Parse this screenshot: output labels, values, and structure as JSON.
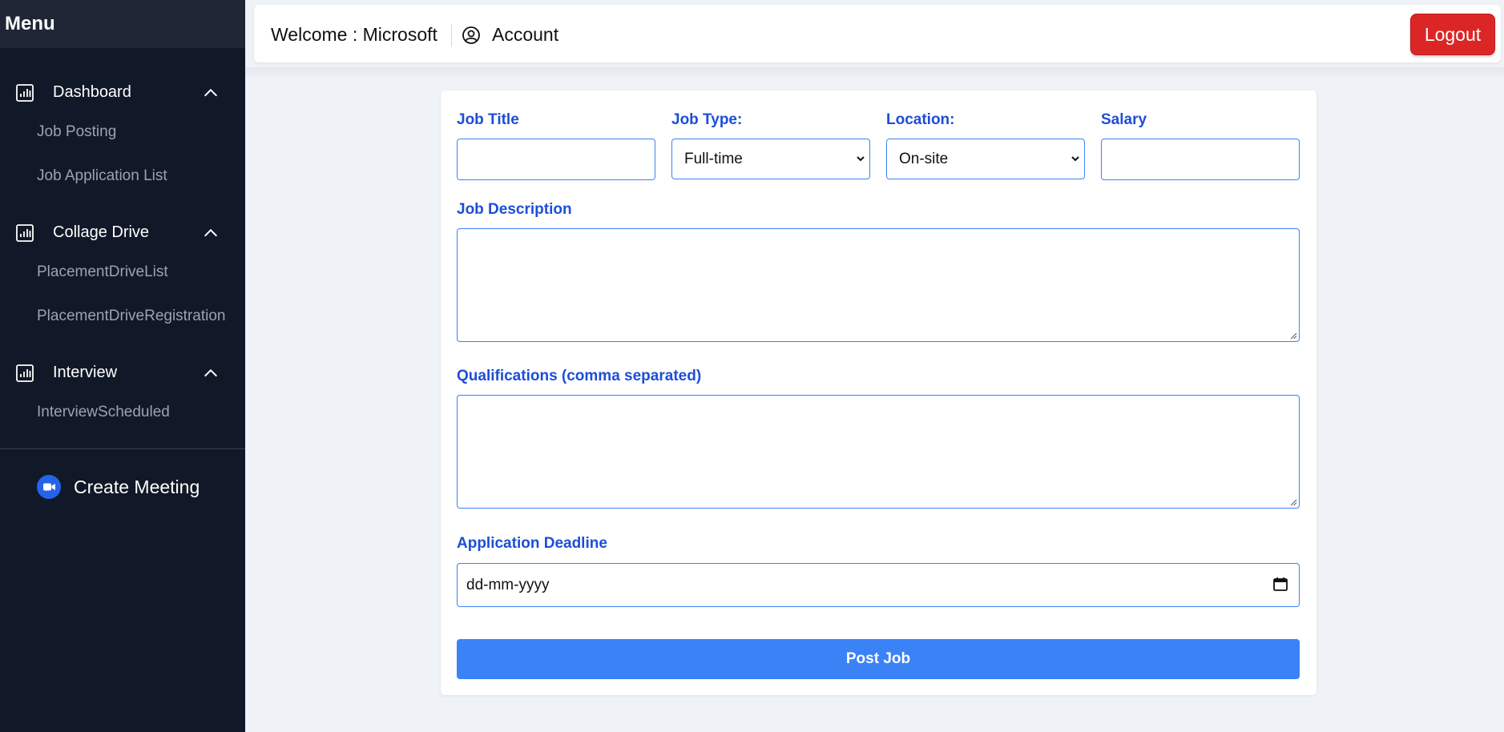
{
  "sidebar": {
    "title": "Menu",
    "sections": [
      {
        "label": "Dashboard",
        "icon": "bar-chart-icon",
        "items": [
          "Job Posting",
          "Job Application List"
        ]
      },
      {
        "label": "Collage Drive",
        "icon": "bar-chart-icon",
        "items": [
          "PlacementDriveList",
          "PlacementDriveRegistration"
        ]
      },
      {
        "label": "Interview",
        "icon": "bar-chart-icon",
        "items": [
          "InterviewScheduled"
        ]
      }
    ],
    "create_meeting": "Create Meeting"
  },
  "header": {
    "welcome": "Welcome : Microsoft",
    "account": "Account",
    "logout": "Logout"
  },
  "form": {
    "job_title_label": "Job Title",
    "job_title_value": "",
    "job_type_label": "Job Type:",
    "job_type_value": "Full-time",
    "location_label": "Location:",
    "location_value": "On-site",
    "salary_label": "Salary",
    "salary_value": "",
    "description_label": "Job Description",
    "qualifications_label": "Qualifications (comma separated)",
    "deadline_label": "Application Deadline",
    "deadline_placeholder": "dd-mm-yyyy",
    "submit_label": "Post Job"
  },
  "colors": {
    "sidebar_bg": "#111827",
    "accent": "#3b82f6",
    "label_blue": "#1d4ed8",
    "logout_red": "#dc2626"
  }
}
